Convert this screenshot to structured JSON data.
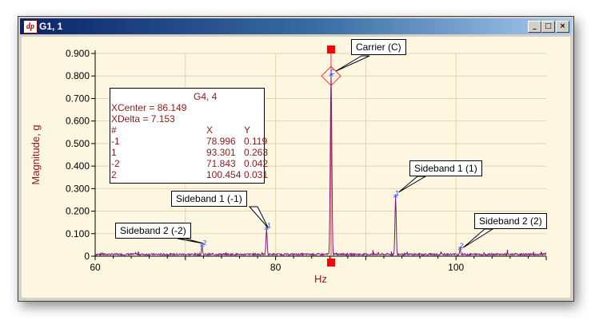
{
  "window": {
    "title": "G1, 1",
    "app_icon": "dp"
  },
  "controls": {
    "minimize": "_",
    "maximize": "□",
    "close": "×"
  },
  "info": {
    "title": "G4, 4",
    "xcenter": "XCenter = 86.149",
    "xdelta": "XDelta = 7.153",
    "col_hash": "#",
    "col_x": "X",
    "col_y": "Y",
    "rows": [
      {
        "n": "-1",
        "x": "78.996",
        "y": "0.119"
      },
      {
        "n": "1",
        "x": "93.301",
        "y": "0.263"
      },
      {
        "n": "-2",
        "x": "71.843",
        "y": "0.042"
      },
      {
        "n": "2",
        "x": "100.454",
        "y": "0.031"
      }
    ]
  },
  "callouts": {
    "carrier": "Carrier (C)",
    "sb1_neg": "Sideband 1 (-1)",
    "sb1_pos": "Sideband 1 (1)",
    "sb2_neg": "Sideband 2 (-2)",
    "sb2_pos": "Sideband 2 (2)"
  },
  "chart_data": {
    "type": "line",
    "xlabel": "Hz",
    "ylabel": "Magnitude, g",
    "xlim": [
      60,
      110
    ],
    "ylim": [
      0,
      0.9
    ],
    "x_ticks": [
      "60",
      "80",
      "100"
    ],
    "y_ticks": [
      "0",
      "0.100",
      "0.200",
      "0.300",
      "0.400",
      "0.500",
      "0.600",
      "0.700",
      "0.800",
      "0.900"
    ],
    "grid": true,
    "line_color": "#7b1a7b",
    "peaks": [
      {
        "x": 86.149,
        "y": 0.8
      },
      {
        "x": 93.301,
        "y": 0.263
      },
      {
        "x": 78.996,
        "y": 0.119
      },
      {
        "x": 71.843,
        "y": 0.042
      },
      {
        "x": 100.454,
        "y": 0.031
      }
    ],
    "markers": [
      {
        "label": "C",
        "x": 86.149,
        "y": 0.8
      },
      {
        "label": "1",
        "x": 93.301,
        "y": 0.263
      },
      {
        "label": "-1",
        "x": 78.996,
        "y": 0.119
      },
      {
        "label": "-2",
        "x": 71.843,
        "y": 0.042
      },
      {
        "label": "2",
        "x": 100.454,
        "y": 0.031
      }
    ]
  }
}
